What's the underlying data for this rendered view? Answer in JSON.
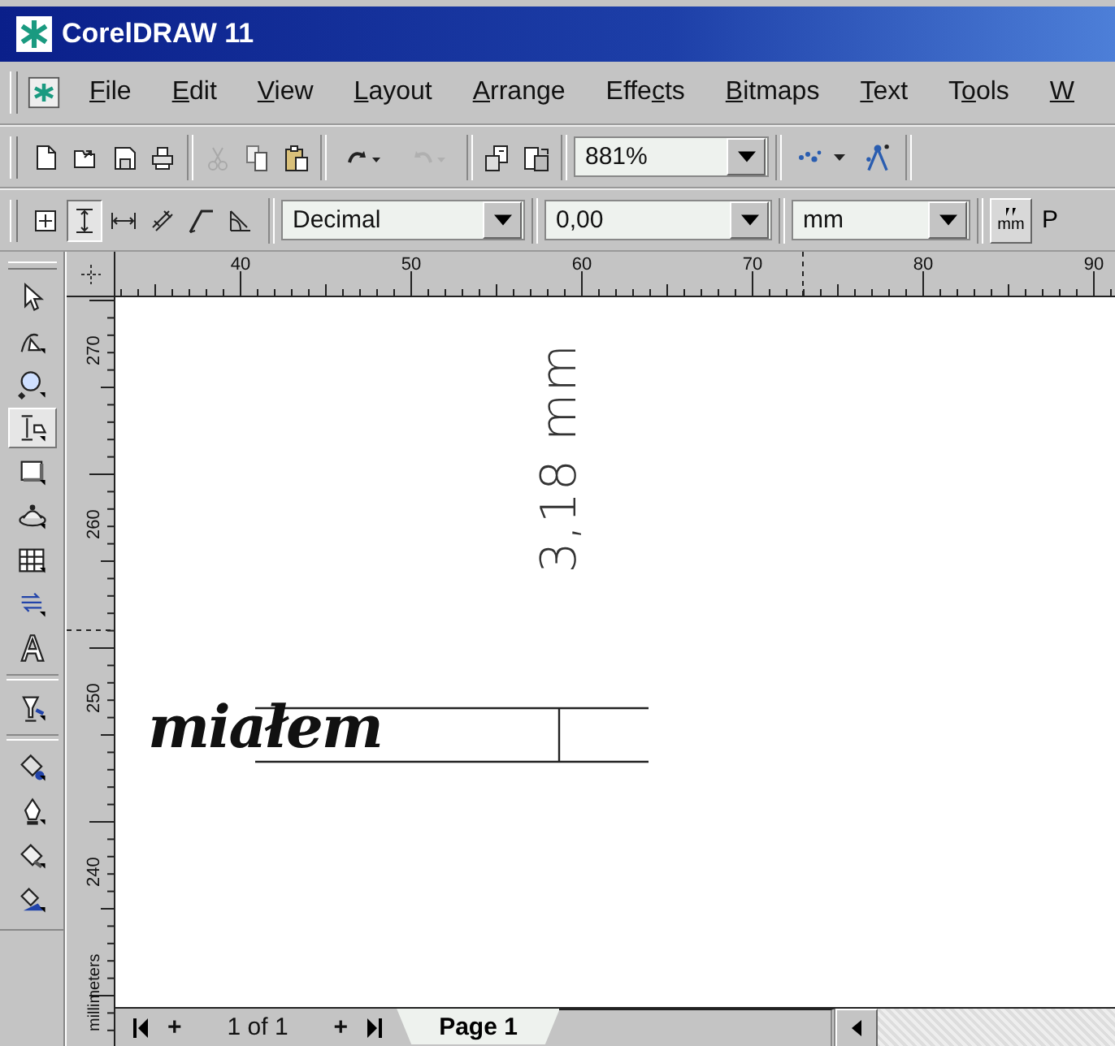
{
  "window": {
    "title": "CorelDRAW 11"
  },
  "menu": [
    {
      "key": "F",
      "post": "ile"
    },
    {
      "key": "E",
      "post": "dit"
    },
    {
      "key": "V",
      "post": "iew"
    },
    {
      "key": "L",
      "post": "ayout"
    },
    {
      "key": "A",
      "post": "rrange"
    },
    {
      "pre": "Effe",
      "key": "c",
      "post": "ts"
    },
    {
      "key": "B",
      "post": "itmaps"
    },
    {
      "key": "T",
      "post": "ext"
    },
    {
      "pre": "T",
      "key": "o",
      "post": "ols"
    },
    {
      "key": "W"
    }
  ],
  "standard_toolbar": {
    "groups": [
      [
        {
          "disabled": false
        },
        {
          "disabled": false
        },
        {
          "disabled": false
        },
        {
          "disabled": false
        }
      ],
      [
        {
          "disabled": true
        },
        {
          "disabled": false
        },
        {
          "disabled": false
        }
      ],
      [
        {
          "disabled": false
        },
        {
          "disabled": true
        }
      ],
      [
        {
          "disabled": false
        },
        {
          "disabled": false
        }
      ]
    ],
    "zoom": "881%"
  },
  "property_bar": {
    "tools": [
      {
        "selected": false
      },
      {
        "selected": true
      },
      {
        "selected": false
      },
      {
        "selected": false
      },
      {
        "selected": false
      },
      {
        "selected": false
      }
    ],
    "style": "Decimal",
    "precision": "0,00",
    "units": "mm",
    "units_button": {
      "label": "mm"
    },
    "cut_label": "P"
  },
  "toolbox": [
    {
      "selected": false
    },
    {
      "selected": false
    },
    {
      "selected": false
    },
    {
      "selected": true
    },
    {
      "selected": false
    },
    {
      "selected": false
    },
    {
      "selected": false
    },
    {
      "selected": false
    },
    {
      "selected": false
    },
    {
      "selected": false
    },
    {
      "selected": false
    },
    {
      "selected": false
    },
    {
      "selected": false
    },
    {
      "selected": false
    }
  ],
  "horizontal_ruler": [
    "40",
    "50",
    "60",
    "70",
    "80",
    "90"
  ],
  "vertical_ruler": [
    "270",
    "260",
    "250",
    "240"
  ],
  "ruler_units": "millimeters",
  "canvas": {
    "dimension_label": "3,18 mm",
    "handwriting": "miałem"
  },
  "page_navigator": {
    "add": "+",
    "count": "1 of 1",
    "add_after": "+",
    "tabs": [
      {
        "label": "Page 1",
        "selected": true
      }
    ]
  }
}
